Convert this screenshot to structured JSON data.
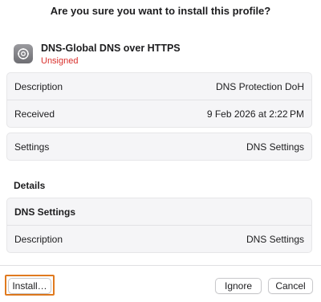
{
  "dialog": {
    "title": "Are you sure you want to install this profile?"
  },
  "profile": {
    "icon": "gear-icon",
    "name": "DNS-Global DNS over HTTPS",
    "status": "Unsigned",
    "status_color": "#d9302c"
  },
  "summary": {
    "rows": [
      {
        "label": "Description",
        "value": "DNS Protection DoH"
      },
      {
        "label": "Received",
        "value": "9 Feb 2026 at 2:22 PM"
      }
    ]
  },
  "settings": {
    "label": "Settings",
    "value": "DNS Settings"
  },
  "details": {
    "title": "Details",
    "section_title": "DNS Settings",
    "rows": [
      {
        "label": "Description",
        "value": "DNS Settings"
      }
    ]
  },
  "buttons": {
    "install": "Install…",
    "ignore": "Ignore",
    "cancel": "Cancel",
    "highlight_color": "#e07a1f"
  }
}
